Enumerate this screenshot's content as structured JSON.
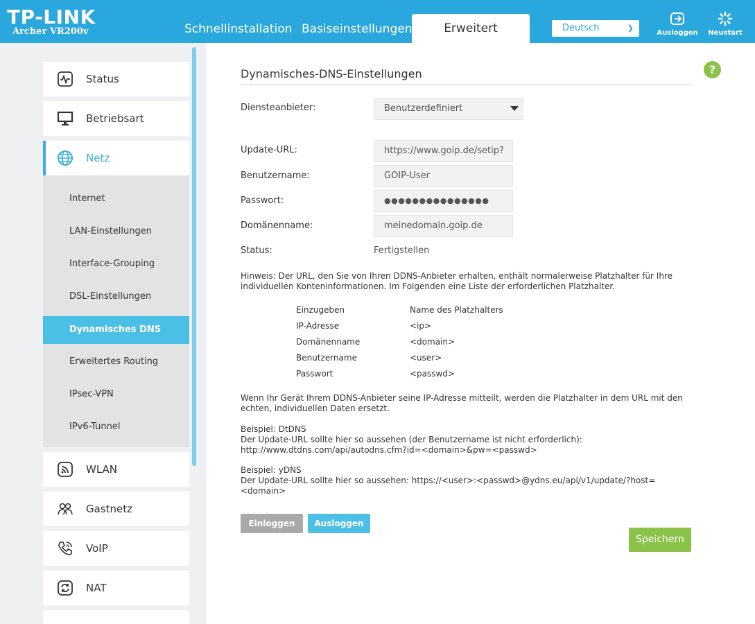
{
  "header": {
    "brand": "TP-LINK",
    "model": "Archer VR200v",
    "tabs": [
      "Schnellinstallation",
      "Basiseinstellungen",
      "Erweitert"
    ],
    "language": "Deutsch",
    "logout_label": "Ausloggen",
    "restart_label": "Neustart"
  },
  "sidebar": {
    "items": [
      {
        "label": "Status",
        "icon": "status-icon"
      },
      {
        "label": "Betriebsart",
        "icon": "monitor-icon"
      },
      {
        "label": "Netz",
        "icon": "globe-icon"
      },
      {
        "label": "WLAN",
        "icon": "wlan-icon"
      },
      {
        "label": "Gastnetz",
        "icon": "guest-network-icon"
      },
      {
        "label": "VoIP",
        "icon": "phone-icon"
      },
      {
        "label": "NAT",
        "icon": "nat-icon"
      }
    ],
    "subitems": [
      "Internet",
      "LAN-Einstellungen",
      "Interface-Grouping",
      "DSL-Einstellungen",
      "Dynamisches DNS",
      "Erweitertes Routing",
      "IPsec-VPN",
      "IPv6-Tunnel"
    ]
  },
  "main": {
    "title": "Dynamisches-DNS-Einstellungen",
    "help": "?",
    "provider_label": "Diensteanbieter:",
    "provider_value": "Benutzerdefiniert",
    "url_label": "Update-URL:",
    "url_value": "https://www.goip.de/setip?",
    "user_label": "Benutzername:",
    "user_value": "GOIP-User",
    "password_label": "Passwort:",
    "password_value": "●●●●●●●●●●●●●●●",
    "domain_label": "Domänenname:",
    "domain_value": "meinedomain.goip.de",
    "status_label": "Status:",
    "status_value": "Fertigstellen",
    "hint_line1": "Hinweis: Der URL, den Sie von Ihren DDNS-Anbieter erhalten, enthält normalerweise Platzhalter für Ihre",
    "hint_line2": "individuellen Konteninformationen. Im Folgenden eine Liste der erforderlichen Platzhalter.",
    "table_header": [
      "Einzugeben",
      "Name des Platzhalters"
    ],
    "table_rows": [
      [
        "IP-Adresse",
        "<ip>"
      ],
      [
        "Domänenname",
        "<domain>"
      ],
      [
        "Benutzername",
        "<user>"
      ],
      [
        "Passwort",
        "<passwd>"
      ]
    ],
    "info_line1": "Wenn Ihr Gerät Ihrem DDNS-Anbieter seine IP-Adresse mitteilt, werden die Platzhalter in dem URL mit den",
    "info_line2": "echten, individuellen Daten ersetzt.",
    "example1_title": "Beispiel: DtDNS",
    "example1_line1": "Der Update-URL sollte hier so aussehen (der Benutzername ist nicht erforderlich):",
    "example1_line2": "http://www.dtdns.com/api/autodns.cfm?id=<domain>&pw=<passwd>",
    "example2_title": "Beispiel: yDNS",
    "example2_line1": "Der Update-URL sollte hier so aussehen: https://<user>:<passwd>@ydns.eu/api/v1/update/?host=",
    "example2_line2": "<domain>",
    "login_label": "Einloggen",
    "logout_label": "Ausloggen",
    "save_label": "Speichern"
  },
  "colors": {
    "header": "#2aa7dc",
    "active_sub": "#4cbfe6",
    "save": "#8bc34a",
    "login_btn": "#a9a9a9",
    "logout_btn": "#4cbfe6"
  }
}
